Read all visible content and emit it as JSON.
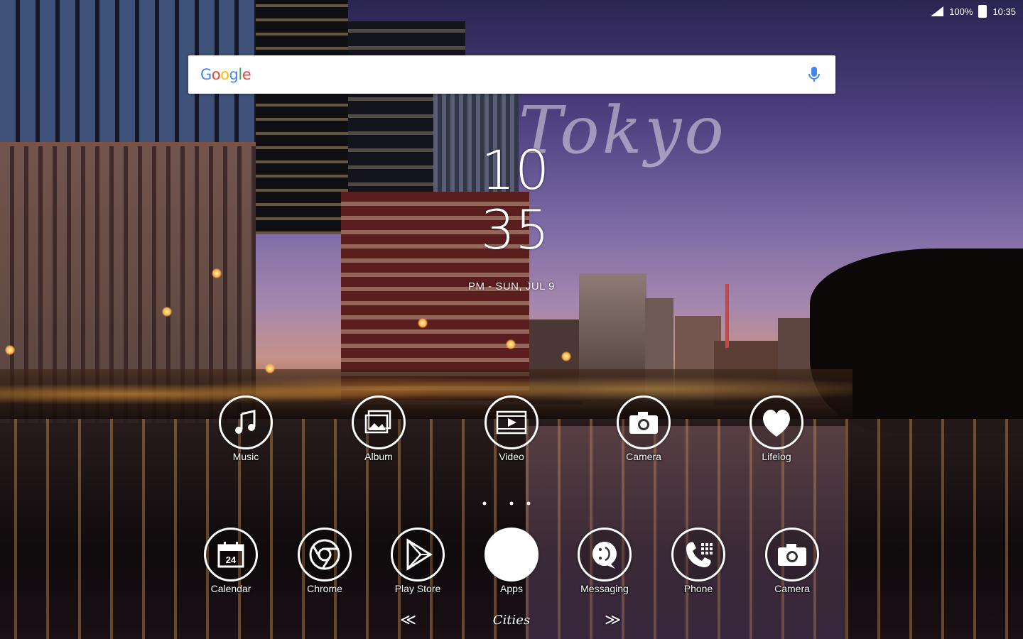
{
  "status_bar": {
    "battery_text": "100%",
    "time": "10:35"
  },
  "search": {
    "logo_text": "Google",
    "logo_colors": [
      "#4285F4",
      "#EA4335",
      "#FBBC05",
      "#4285F4",
      "#34A853",
      "#EA4335"
    ],
    "mic_color": "#4285F4"
  },
  "clock": {
    "hours": "10",
    "minutes": "35",
    "date_line": "PM - SUN, JUL 9",
    "watermark": "Tokyo"
  },
  "dock_row_1": [
    {
      "label": "Music",
      "icon": "music-note-icon"
    },
    {
      "label": "Album",
      "icon": "photo-album-icon"
    },
    {
      "label": "Video",
      "icon": "video-play-icon"
    },
    {
      "label": "Camera",
      "icon": "camera-icon"
    },
    {
      "label": "Lifelog",
      "icon": "heart-icon"
    }
  ],
  "dock_row_2": [
    {
      "label": "Calendar",
      "icon": "calendar-icon",
      "calendar_day": "24"
    },
    {
      "label": "Chrome",
      "icon": "chrome-icon"
    },
    {
      "label": "Play Store",
      "icon": "play-store-icon"
    },
    {
      "label": "Apps",
      "icon": "apps-drawer-icon"
    },
    {
      "label": "Messaging",
      "icon": "messaging-icon"
    },
    {
      "label": "Phone",
      "icon": "phone-icon"
    },
    {
      "label": "Camera",
      "icon": "camera-icon"
    }
  ],
  "page_nav": {
    "prev_glyph": "≪",
    "next_glyph": "≫",
    "page_name": "Cities"
  }
}
